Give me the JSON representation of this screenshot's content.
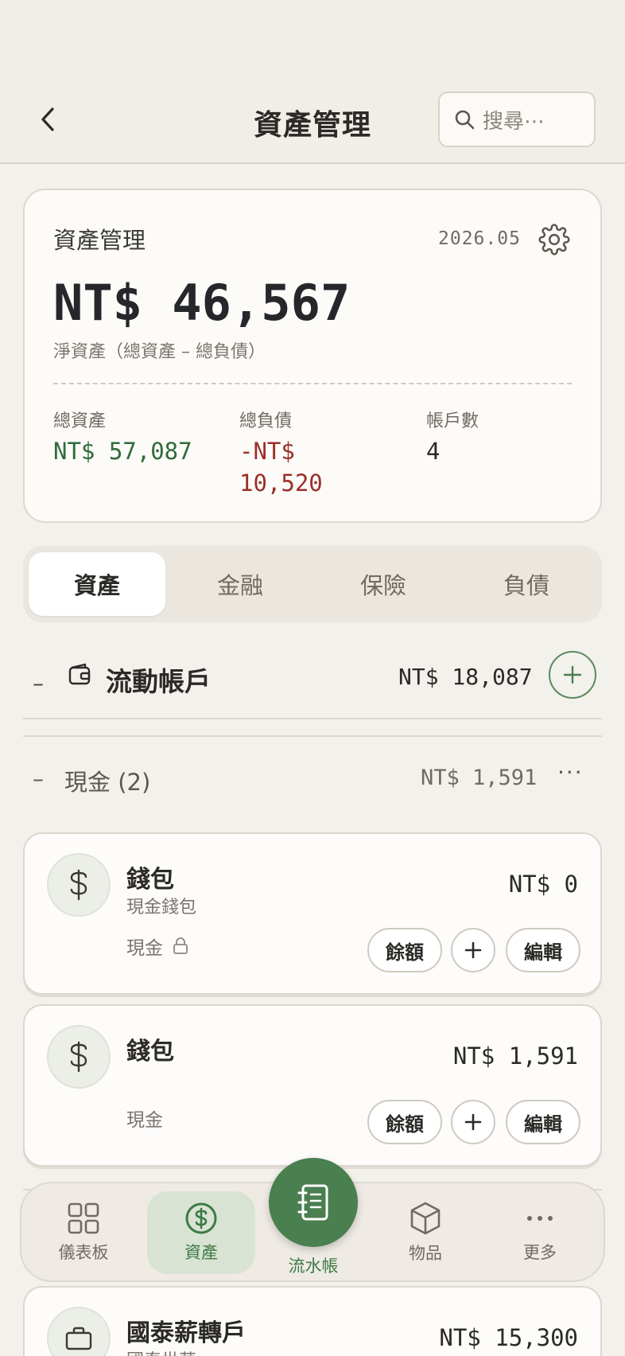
{
  "header": {
    "title": "資產管理",
    "search_placeholder": "搜尋⋯"
  },
  "summary": {
    "title": "資產管理",
    "period": "2026.05",
    "net_worth": "NT$ 46,567",
    "net_worth_label": "淨資產（總資產 – 總負債）",
    "stats": [
      {
        "label": "總資產",
        "value": "NT$ 57,087",
        "color": "#2f6b3a"
      },
      {
        "label": "總負債",
        "value": "-NT$ 10,520",
        "color": "#9a2f2a"
      },
      {
        "label": "帳戶數",
        "value": "4",
        "color": "#2c2a26"
      }
    ]
  },
  "tabs": [
    {
      "label": "資產",
      "active": true
    },
    {
      "label": "金融",
      "active": false
    },
    {
      "label": "保險",
      "active": false
    },
    {
      "label": "負債",
      "active": false
    }
  ],
  "group": {
    "collapse": "–",
    "title": "流動帳戶",
    "amount": "NT$ 18,087"
  },
  "subgroup": {
    "collapse": "–",
    "title": "現金 (2)",
    "amount": "NT$ 1,591",
    "more": "···"
  },
  "accounts": [
    {
      "name": "錢包",
      "subtitle": "現金錢包",
      "amount": "NT$ 0",
      "type": "現金",
      "locked": true,
      "icon": "dollar-icon",
      "actions": {
        "balance": "餘額",
        "add": "+",
        "edit": "編輯"
      }
    },
    {
      "name": "錢包",
      "subtitle": "",
      "amount": "NT$ 1,591",
      "type": "現金",
      "locked": false,
      "icon": "dollar-icon",
      "actions": {
        "balance": "餘額",
        "add": "+",
        "edit": "編輯"
      }
    },
    {
      "name": "國泰薪轉戶",
      "subtitle": "國泰世華",
      "amount": "NT$ 15,300",
      "icon": "briefcase-icon"
    }
  ],
  "bottom_nav": {
    "items": [
      {
        "label": "儀表板",
        "icon": "grid-icon"
      },
      {
        "label": "資產",
        "icon": "dollar-circle-icon",
        "active": true
      },
      {
        "label": "流水帳",
        "icon": "notebook-icon"
      },
      {
        "label": "物品",
        "icon": "box-icon"
      },
      {
        "label": "更多",
        "icon": "more-icon"
      }
    ]
  },
  "colors": {
    "accent": "#4a7f4f",
    "positive": "#2f6b3a",
    "negative": "#9a2f2a",
    "background": "#f3f1ec"
  }
}
